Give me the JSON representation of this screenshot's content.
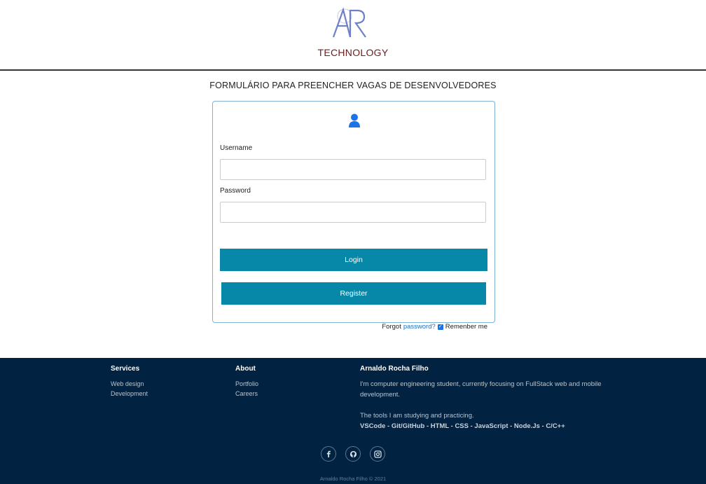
{
  "header": {
    "brand": "TECHNOLOGY"
  },
  "form": {
    "title": "FORMULÁRIO PARA PREENCHER VAGAS DE DESENVOLVEDORES",
    "username_label": "Username",
    "username_value": "",
    "password_label": "Password",
    "password_value": "",
    "login_label": "Login",
    "register_label": "Register",
    "forgot_prefix": "Forgot",
    "forgot_link": "password?",
    "remember_label": "Remenber me",
    "remember_checked": true
  },
  "footer": {
    "services": {
      "heading": "Services",
      "items": [
        "Web design",
        "Development"
      ]
    },
    "about": {
      "heading": "About",
      "items": [
        "Portfolio",
        "Careers"
      ]
    },
    "author": {
      "heading": "Arnaldo Rocha Filho",
      "description": "I'm computer engineering student, currently focusing on FullStack web and mobile development.",
      "tools_intro": "The tools I am studying and practicing.",
      "tools_list": "VSCode - Git/GitHub - HTML - CSS - JavaScript - Node.Js - C/C++"
    },
    "social": [
      "facebook-icon",
      "github-icon",
      "instagram-icon"
    ],
    "copyright": "Arnaldo Rocha Filho © 2021"
  },
  "colors": {
    "accent_button": "#0788a9",
    "footer_bg": "#012241",
    "brand_text": "#6b1c1c",
    "user_icon": "#1a73e8"
  }
}
